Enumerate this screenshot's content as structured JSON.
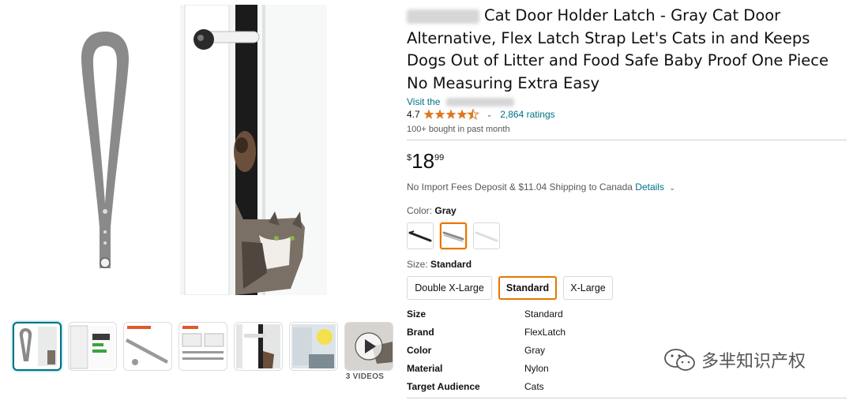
{
  "product": {
    "title": "Cat Door Holder Latch - Gray Cat Door Alternative, Flex Latch Strap Let's Cats in and Keeps Dogs Out of Litter and Food Safe Baby Proof One Piece No Measuring Extra Easy",
    "store_prefix": "Visit the",
    "rating_value": "4.7",
    "rating_stars": 4.7,
    "ratings_count": "2,864 ratings",
    "bought": "100+ bought in past month",
    "price": {
      "currency": "$",
      "whole": "18",
      "fraction": "99"
    },
    "shipping_text": "No Import Fees Deposit & $11.04 Shipping to Canada",
    "shipping_link": "Details",
    "color_label": "Color:",
    "color_value": "Gray",
    "size_label": "Size:",
    "size_value": "Standard",
    "sizes": [
      "Double X-Large",
      "Standard",
      "X-Large"
    ],
    "videos_label": "3 VIDEOS",
    "specs": [
      {
        "key": "Size",
        "value": "Standard"
      },
      {
        "key": "Brand",
        "value": "FlexLatch"
      },
      {
        "key": "Color",
        "value": "Gray"
      },
      {
        "key": "Material",
        "value": "Nylon"
      },
      {
        "key": "Target Audience",
        "value": "Cats"
      }
    ]
  },
  "watermark": {
    "text": "多芈知识产权"
  },
  "colors": {
    "link": "#007185",
    "star": "#de7921",
    "selected_border": "#e77600",
    "strap": "#8a8a8a"
  },
  "icons": {
    "video_play": "play-icon",
    "rating_chevron": "chevron-down-icon",
    "watermark_logo": "wechat-icon"
  }
}
